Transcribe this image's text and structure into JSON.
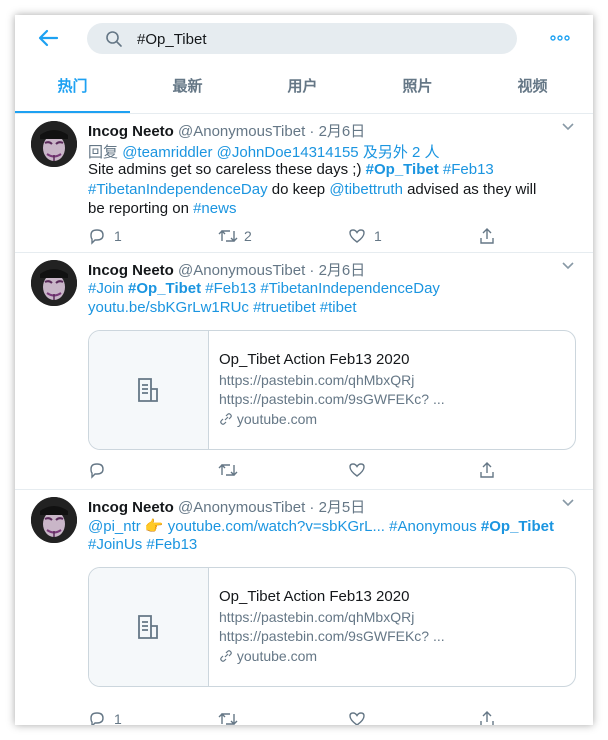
{
  "search": {
    "query": "#Op_Tibet"
  },
  "tabs": [
    {
      "label": "热门",
      "active": true
    },
    {
      "label": "最新"
    },
    {
      "label": "用户"
    },
    {
      "label": "照片"
    },
    {
      "label": "视频"
    }
  ],
  "tweets": [
    {
      "name": "Incog Neeto",
      "handle": "@AnonymousTibet",
      "sep": "·",
      "date": "2月6日",
      "reply_prefix": "回复",
      "reply_to_1": "@teamriddler",
      "reply_to_2": "@JohnDoe14314155",
      "reply_more": "及另外 2 人",
      "text_1": "Site admins get so careless these days ;)",
      "tag_op": "#Op_Tibet",
      "tag_feb": "#Feb13",
      "tag_tid": "#TibetanIndependenceDay",
      "text_2": "do keep",
      "mention": "@tibettruth",
      "text_3": "advised as they will",
      "text_4": "be reporting on",
      "tag_news": "#news",
      "replies": "1",
      "retweets": "2",
      "likes": "1"
    },
    {
      "name": "Incog Neeto",
      "handle": "@AnonymousTibet",
      "sep": "·",
      "date": "2月6日",
      "tag_join": "#Join",
      "tag_op": "#Op_Tibet",
      "tag_feb": "#Feb13",
      "tag_tid": "#TibetanIndependenceDay",
      "link_yt": "youtu.be/sbKGrLw1RUc",
      "tag_truetibet": "#truetibet",
      "tag_tibet": "#tibet",
      "card": {
        "title": "Op_Tibet Action Feb13 2020",
        "line1": "https://pastebin.com/qhMbxQRj",
        "line2": "https://pastebin.com/9sGWFEKc? ...",
        "domain": "youtube.com"
      }
    },
    {
      "name": "Incog Neeto",
      "handle": "@AnonymousTibet",
      "sep": "·",
      "date": "2月5日",
      "mention": "@pi_ntr",
      "emoji": "👉",
      "link_yt": "youtube.com/watch?v=sbKGrL...",
      "tag_anon": "#Anonymous",
      "tag_op": "#Op_Tibet",
      "tag_joinus": "#JoinUs",
      "tag_feb": "#Feb13",
      "card": {
        "title": "Op_Tibet Action Feb13 2020",
        "line1": "https://pastebin.com/qhMbxQRj",
        "line2": "https://pastebin.com/9sGWFEKc? ...",
        "domain": "youtube.com"
      },
      "replies": "1"
    }
  ],
  "colors": {
    "accent": "#1da1f2",
    "link": "#1b95e0",
    "muted": "#657786"
  },
  "icons": [
    "back-arrow-icon",
    "search-icon",
    "more-icon",
    "chevron-down-icon",
    "reply-icon",
    "retweet-icon",
    "like-icon",
    "share-icon",
    "document-icon",
    "link-icon"
  ]
}
